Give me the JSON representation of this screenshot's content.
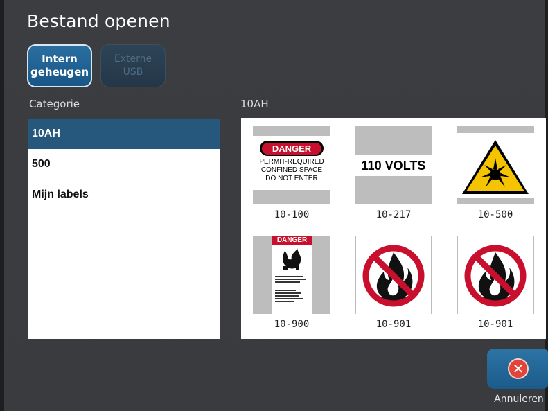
{
  "dialog": {
    "title": "Bestand openen"
  },
  "sources": [
    {
      "line1": "Intern",
      "line2": "geheugen",
      "active": true
    },
    {
      "line1": "Externe",
      "line2": "USB",
      "active": false
    }
  ],
  "categories": {
    "heading": "Categorie",
    "items": [
      {
        "label": "10AH",
        "selected": true
      },
      {
        "label": "500",
        "selected": false
      },
      {
        "label": "Mijn labels",
        "selected": false
      }
    ]
  },
  "gallery": {
    "heading": "10AH",
    "items": [
      {
        "label": "10-100",
        "icon": "danger-permit-required-sign",
        "text": [
          "DANGER",
          "PERMIT-REQUIRED",
          "CONFINED SPACE",
          "DO NOT ENTER"
        ]
      },
      {
        "label": "10-217",
        "icon": "110-volts-sign",
        "text": [
          "110 VOLTS"
        ]
      },
      {
        "label": "10-500",
        "icon": "explosive-warning-triangle-icon"
      },
      {
        "label": "10-900",
        "icon": "danger-fire-sign",
        "text": [
          "DANGER"
        ]
      },
      {
        "label": "10-901",
        "icon": "no-open-flame-icon"
      },
      {
        "label": "10-901",
        "icon": "no-open-flame-icon"
      }
    ]
  },
  "footer": {
    "cancel_label": "Annuleren"
  },
  "colors": {
    "background": "#3a3c40",
    "accent": "#26587e",
    "danger_red": "#c8102e",
    "cancel_red": "#e0453a"
  }
}
